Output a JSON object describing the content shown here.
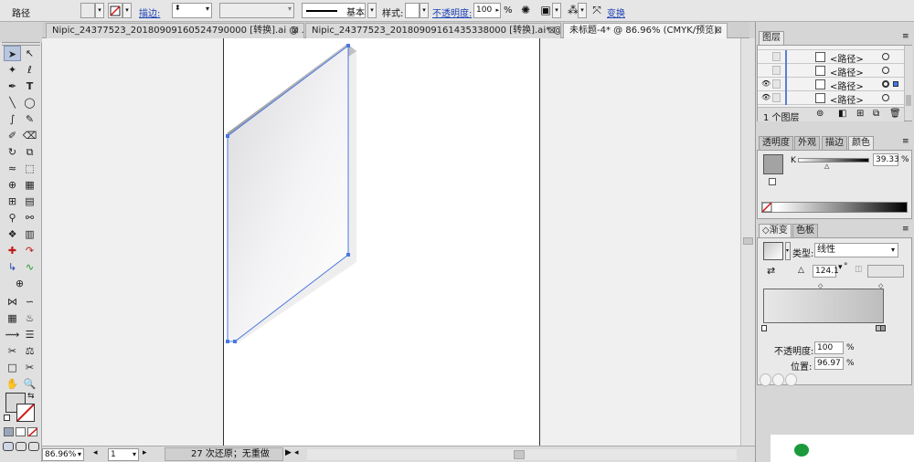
{
  "control_bar": {
    "object_type": "路径",
    "stroke_label": "描边:",
    "brush_label": "基本",
    "style_label": "样式:",
    "opacity_label": "不透明度:",
    "opacity_value": "100",
    "opacity_unit": "%",
    "transform_label": "变换"
  },
  "tabs": [
    {
      "label": "Nipic_24377523_20180909160524790000 [转换].ai @ ...",
      "active": false
    },
    {
      "label": "Nipic_24377523_20180909161435338000 [转换].ai* @ ...",
      "active": false
    },
    {
      "label": "未标题-4* @ 86.96% (CMYK/预览)",
      "active": true
    }
  ],
  "status_bar": {
    "zoom": "86.96%",
    "page": "1",
    "history": "27 次还原；无重做"
  },
  "layers_panel": {
    "title": "图层",
    "rows": [
      {
        "name": "<路径>",
        "visible": false
      },
      {
        "name": "<路径>",
        "visible": false
      },
      {
        "name": "<路径>",
        "visible": true
      },
      {
        "name": "<路径>",
        "visible": true
      }
    ],
    "footer": "1 个图层"
  },
  "color_panel": {
    "tabs": [
      "透明度",
      "外观",
      "描边",
      "颜色"
    ],
    "channel": "K",
    "value": "39.33",
    "unit": "%"
  },
  "gradient_panel": {
    "tabs": [
      "渐变",
      "色板"
    ],
    "type_label": "类型:",
    "type_value": "线性",
    "angle": "124.1",
    "angle_unit": "°",
    "opacity_label": "不透明度:",
    "opacity_value": "100",
    "location_label": "位置:",
    "location_value": "96.97",
    "unit": "%"
  },
  "colors": {
    "selection_blue": "#4a78e0",
    "panel_bg": "#e9e9e9"
  }
}
